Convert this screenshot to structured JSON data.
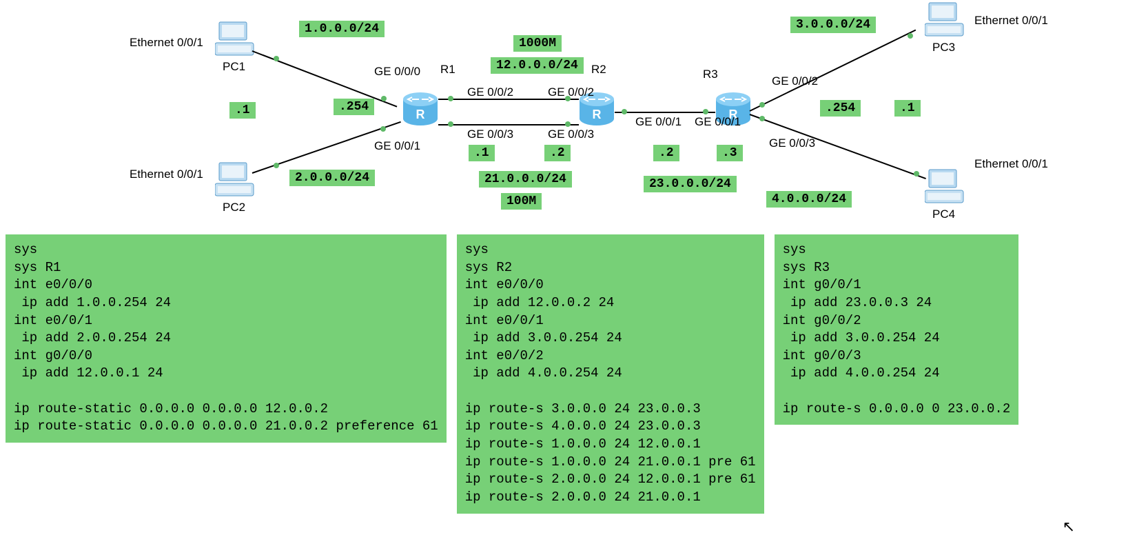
{
  "nets": {
    "n1": "1.0.0.0/24",
    "n2": "2.0.0.0/24",
    "n3": "3.0.0.0/24",
    "n4": "4.0.0.0/24",
    "n12": "12.0.0.0/24",
    "n21": "21.0.0.0/24",
    "n23": "23.0.0.0/24"
  },
  "speeds": {
    "top": "1000M",
    "bottom": "100M"
  },
  "hosts": {
    "pc1": {
      "name": "PC1",
      "intf": "Ethernet 0/0/1",
      "ip": ".1"
    },
    "pc2": {
      "name": "PC2",
      "intf": "Ethernet 0/0/1",
      "ip": ".1"
    },
    "pc3": {
      "name": "PC3",
      "intf": "Ethernet 0/0/1",
      "ip": ".1"
    },
    "pc4": {
      "name": "PC4",
      "intf": "Ethernet 0/0/1",
      "ip": ".1"
    }
  },
  "routers": {
    "r1": {
      "name": "R1",
      "gw": ".254"
    },
    "r2": {
      "name": "R2"
    },
    "r3": {
      "name": "R3",
      "gw": ".254"
    }
  },
  "ports": {
    "r1_ge000": "GE 0/0/0",
    "r1_ge001": "GE 0/0/1",
    "r1_ge002": "GE 0/0/2",
    "r1_ge003": "GE 0/0/3",
    "r2_ge002": "GE 0/0/2",
    "r2_ge003": "GE 0/0/3",
    "r2_ge001": "GE 0/0/1",
    "r3_ge001": "GE 0/0/1",
    "r3_ge002": "GE 0/0/2",
    "r3_ge003": "GE 0/0/3"
  },
  "ips": {
    "r1_top": ".1",
    "r2_top": ".2",
    "r2_right": ".2",
    "r3_left": ".3"
  },
  "config": {
    "r1": "sys\nsys R1\nint e0/0/0\n ip add 1.0.0.254 24\nint e0/0/1\n ip add 2.0.0.254 24\nint g0/0/0\n ip add 12.0.0.1 24\n\nip route-static 0.0.0.0 0.0.0.0 12.0.0.2\nip route-static 0.0.0.0 0.0.0.0 21.0.0.2 preference 61",
    "r2": "sys\nsys R2\nint e0/0/0\n ip add 12.0.0.2 24\nint e0/0/1\n ip add 3.0.0.254 24\nint e0/0/2\n ip add 4.0.0.254 24\n\nip route-s 3.0.0.0 24 23.0.0.3\nip route-s 4.0.0.0 24 23.0.0.3\nip route-s 1.0.0.0 24 12.0.0.1\nip route-s 1.0.0.0 24 21.0.0.1 pre 61\nip route-s 2.0.0.0 24 12.0.0.1 pre 61\nip route-s 2.0.0.0 24 21.0.0.1",
    "r3": "sys\nsys R3\nint g0/0/1\n ip add 23.0.0.3 24\nint g0/0/2\n ip add 3.0.0.254 24\nint g0/0/3\n ip add 4.0.0.254 24\n\nip route-s 0.0.0.0 0 23.0.0.2"
  }
}
